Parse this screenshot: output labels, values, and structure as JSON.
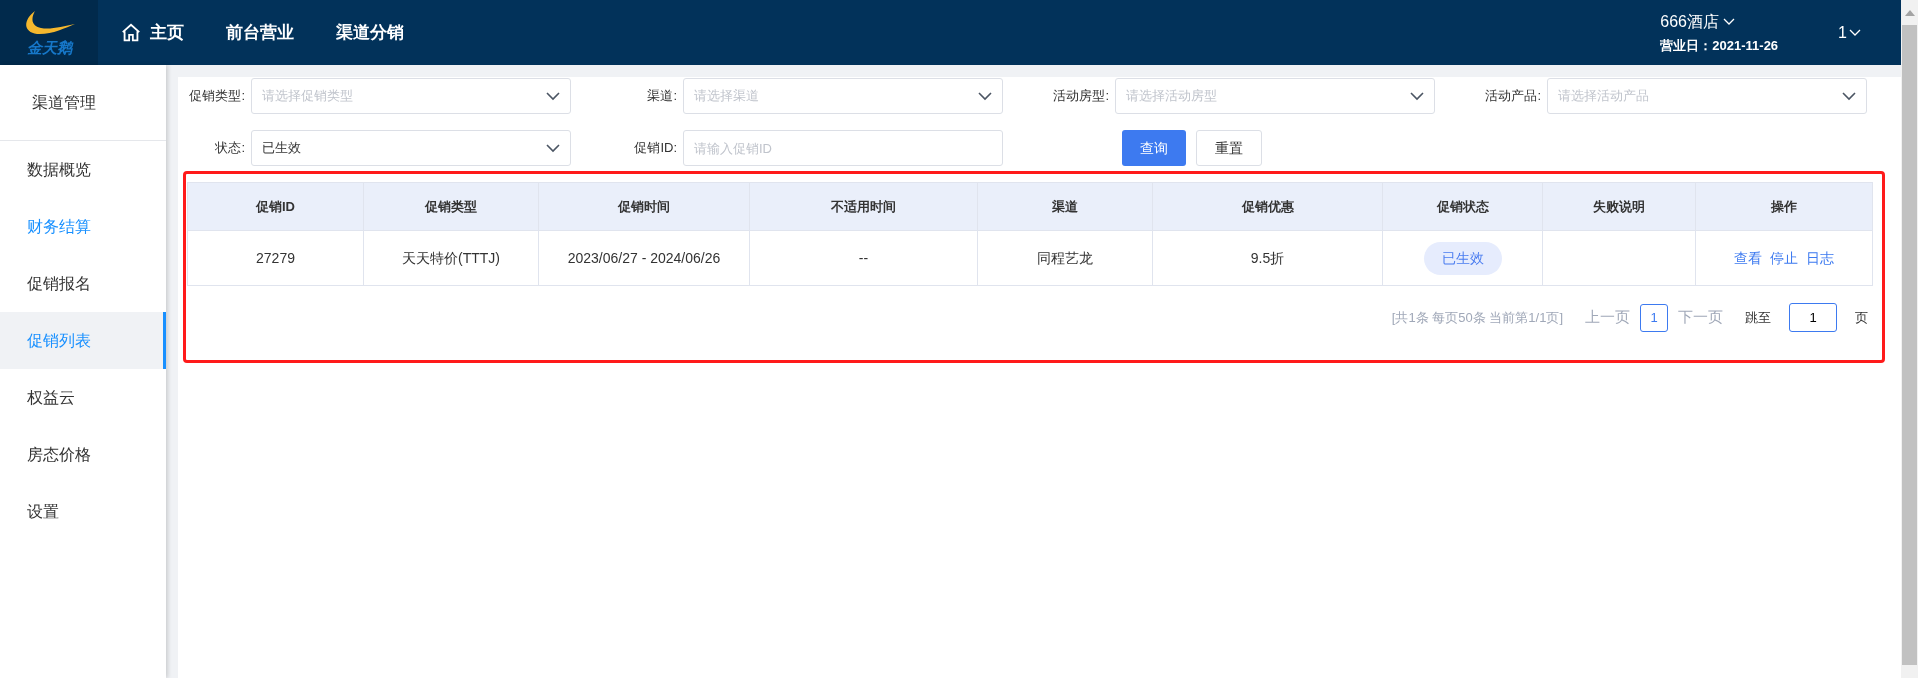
{
  "header": {
    "logo_text": "金天鹅",
    "nav": [
      {
        "label": "主页",
        "kind": "home"
      },
      {
        "label": "前台营业"
      },
      {
        "label": "渠道分销"
      }
    ],
    "hotel": "666酒店",
    "business_date": "营业日：2021-11-26",
    "user": "1"
  },
  "sidebar": {
    "title": "渠道管理",
    "items": [
      {
        "label": "数据概览",
        "selected": false,
        "highlighted": false
      },
      {
        "label": "财务结算",
        "selected": false,
        "highlighted": true
      },
      {
        "label": "促销报名",
        "selected": false,
        "highlighted": false
      },
      {
        "label": "促销列表",
        "selected": true,
        "highlighted": true
      },
      {
        "label": "权益云",
        "selected": false,
        "highlighted": false
      },
      {
        "label": "房态价格",
        "selected": false,
        "highlighted": false
      },
      {
        "label": "设置",
        "selected": false,
        "highlighted": false
      }
    ]
  },
  "filters": [
    [
      {
        "label": "促销类型:",
        "kind": "select",
        "placeholder": "请选择促销类型"
      },
      {
        "label": "渠道:",
        "kind": "select",
        "placeholder": "请选择渠道"
      },
      {
        "label": "活动房型:",
        "kind": "select",
        "placeholder": "请选择活动房型"
      },
      {
        "label": "活动产品:",
        "kind": "select",
        "placeholder": "请选择活动产品"
      }
    ],
    [
      {
        "label": "状态:",
        "kind": "select",
        "value": "已生效"
      },
      {
        "label": "促销ID:",
        "kind": "input",
        "placeholder": "请输入促销ID"
      }
    ]
  ],
  "buttons": [
    {
      "label": "查询",
      "kind": "primary"
    },
    {
      "label": "重置",
      "kind": "default"
    }
  ],
  "table": {
    "columns": [
      "促销ID",
      "促销类型",
      "促销时间",
      "不适用时间",
      "渠道",
      "促销优惠",
      "促销状态",
      "失败说明",
      "操作"
    ],
    "rows": [
      {
        "cells": [
          "27279",
          "天天特价(TTTJ)",
          "2023/06/27 - 2024/06/26",
          "--",
          "同程艺龙",
          "9.5折"
        ],
        "status": "已生效",
        "actions": [
          "查看",
          "停止",
          "日志"
        ]
      }
    ]
  },
  "pagination": {
    "summary": "[共1条 每页50条 当前第1/1页]",
    "prev": "上一页",
    "pages": [
      {
        "label": "1",
        "selected": true
      }
    ],
    "next": "下一页",
    "jump_label": "跳至",
    "jump_value": "1",
    "page_unit": "页"
  }
}
